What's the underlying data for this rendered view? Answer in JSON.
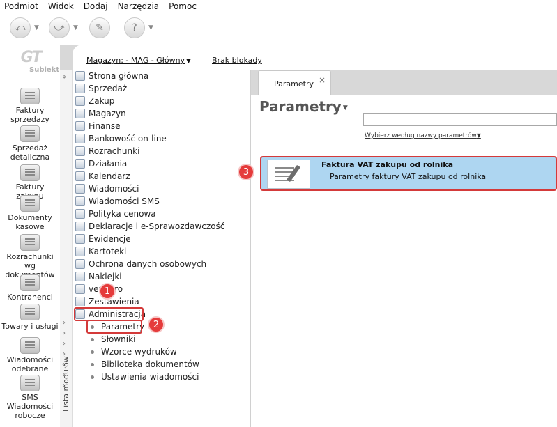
{
  "menu": [
    "Podmiot",
    "Widok",
    "Dodaj",
    "Narzędzia",
    "Pomoc"
  ],
  "logo": {
    "mark": "GT",
    "text": "Subiekt"
  },
  "launcher": [
    {
      "name": "faktury-sprzedazy",
      "label": "Faktury sprzedaży"
    },
    {
      "name": "sprzedaz-detaliczna",
      "label": "Sprzedaż detaliczna"
    },
    {
      "name": "faktury-zakupu",
      "label": "Faktury zakupu"
    },
    {
      "name": "dokumenty-kasowe",
      "label": "Dokumenty kasowe"
    },
    {
      "name": "rozrachunki",
      "label": "Rozrachunki wg dokumentów"
    },
    {
      "name": "kontrahenci",
      "label": "Kontrahenci"
    },
    {
      "name": "towary",
      "label": "Towary i usługi"
    },
    {
      "name": "wiadomosci-odebrane",
      "label": "Wiadomości odebrane"
    },
    {
      "name": "sms",
      "label": "SMS Wiadomości robocze"
    }
  ],
  "header": {
    "magazyn": "Magazyn: - MAG - Główny",
    "blokada": "Brak blokady"
  },
  "strip_label": "Lista modułów",
  "tree": [
    "Strona główna",
    "Sprzedaż",
    "Zakup",
    "Magazyn",
    "Finanse",
    "Bankowość on-line",
    "Rozrachunki",
    "Działania",
    "Kalendarz",
    "Wiadomości",
    "Wiadomości SMS",
    "Polityka cenowa",
    "Deklaracje i e-Sprawozdawczość",
    "Ewidencje",
    "Kartoteki",
    "Ochrona danych osobowych",
    "Naklejki",
    "vendero",
    "Zestawienia",
    "Administracja"
  ],
  "admin_children": [
    "Parametry",
    "Słowniki",
    "Wzorce wydruków",
    "Biblioteka dokumentów",
    "Ustawienia wiadomości"
  ],
  "badges": [
    "1",
    "2",
    "3"
  ],
  "tab": {
    "label": "Parametry",
    "close": "×"
  },
  "page_title": "Parametry",
  "search": {
    "value": "",
    "choose": "Wybierz według nazwy parametrów"
  },
  "card": {
    "title": "Faktura VAT zakupu od rolnika",
    "subtitle": "Parametry faktury VAT zakupu od rolnika"
  },
  "colors": {
    "selected": "#aed6f1",
    "highlight": "#d43a3a",
    "frame": "#d8d8d8"
  }
}
